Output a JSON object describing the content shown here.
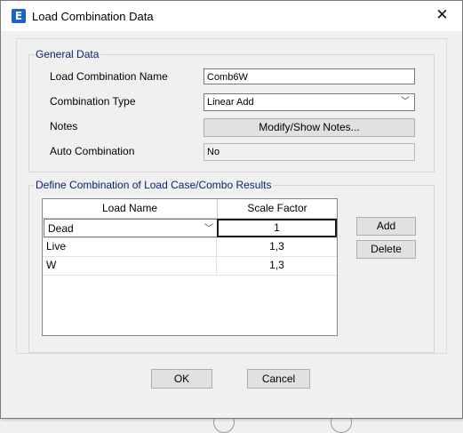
{
  "window": {
    "title": "Load Combination Data",
    "close_glyph": "✕",
    "app_icon_letter": "E"
  },
  "general": {
    "group_label": "General Data",
    "name_label": "Load Combination Name",
    "name_value": "Comb6W",
    "type_label": "Combination Type",
    "type_value": "Linear Add",
    "notes_label": "Notes",
    "notes_button": "Modify/Show Notes...",
    "auto_label": "Auto Combination",
    "auto_value": "No"
  },
  "define": {
    "group_label": "Define Combination of Load Case/Combo Results",
    "columns": [
      "Load Name",
      "Scale Factor"
    ],
    "rows": [
      {
        "name": "Dead",
        "factor": "1"
      },
      {
        "name": "Live",
        "factor": "1,3"
      },
      {
        "name": "W",
        "factor": "1,3"
      }
    ],
    "add_button": "Add",
    "delete_button": "Delete"
  },
  "footer": {
    "ok_button": "OK",
    "cancel_button": "Cancel"
  },
  "icons": {
    "combo_arrow": "chevron-down-icon",
    "app": "etabs-app-icon"
  },
  "colors": {
    "group_label": "#0a246a",
    "app_icon": "#1b62c9",
    "dialog_bg": "#f0f0f0"
  }
}
